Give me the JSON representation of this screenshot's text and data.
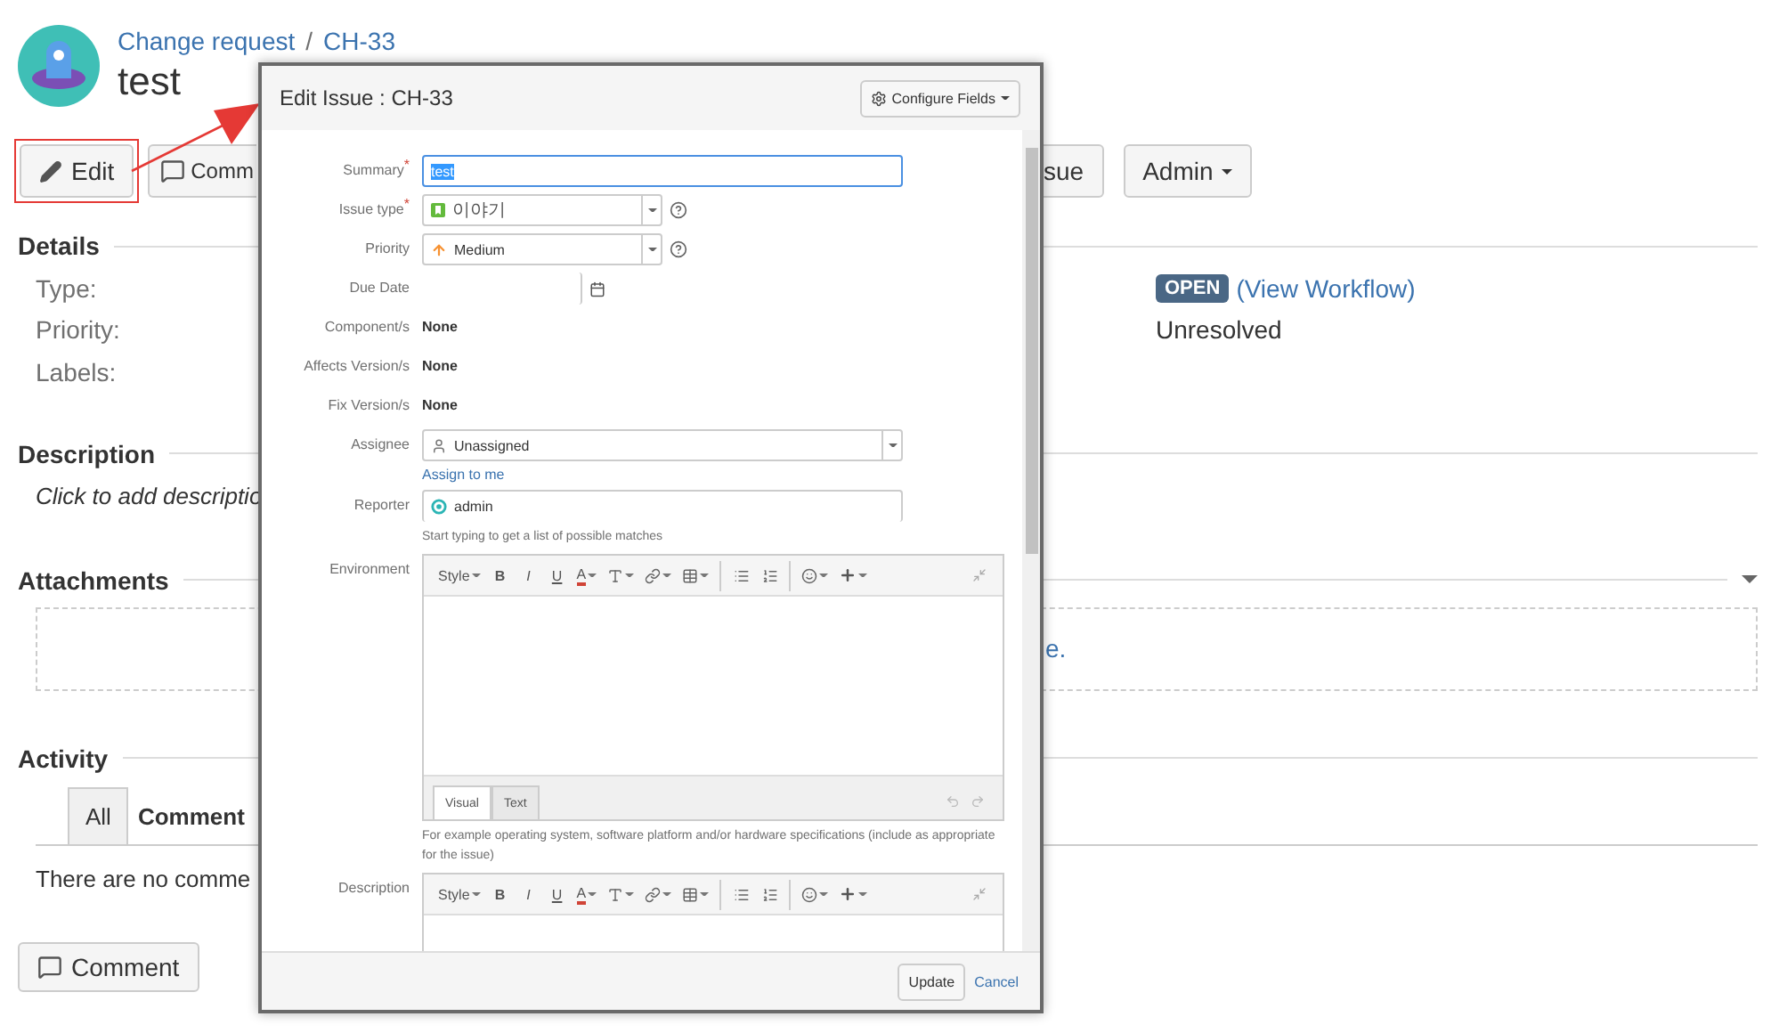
{
  "breadcrumb": {
    "items": [
      "Change request",
      "CH-33"
    ],
    "separator": "/"
  },
  "issue_title": "test",
  "actions_left": [
    {
      "kind": "edit",
      "label": "Edit",
      "highlighted": true
    },
    {
      "kind": "comment",
      "label": "Comm",
      "highlighted": false
    }
  ],
  "actions_right": [
    {
      "kind": "plain",
      "label": "sue"
    },
    {
      "kind": "dropdown",
      "label": "Admin"
    }
  ],
  "details": {
    "heading": "Details",
    "labels": [
      "Type:",
      "Priority:",
      "Labels:"
    ],
    "status": "OPEN",
    "workflow_link": "(View Workflow)",
    "resolution": "Unresolved"
  },
  "description": {
    "heading": "Description",
    "prompt": "Click to add descriptio"
  },
  "attachments": {
    "heading": "Attachments",
    "drop_text": "e."
  },
  "activity": {
    "heading": "Activity",
    "tabs": [
      {
        "label": "All",
        "selected": false
      },
      {
        "label": "Comment",
        "selected": true
      }
    ],
    "empty_text": "There are no comme"
  },
  "comment_button": "Comment",
  "dialog": {
    "title": "Edit Issue : CH-33",
    "configure_button": "Configure Fields",
    "required_mark": "*",
    "fields": [
      {
        "kind": "text",
        "label": "Summary",
        "required": true,
        "value": "test",
        "value_selected": true
      },
      {
        "kind": "issue_type_select",
        "label": "Issue type",
        "required": true,
        "value": "이야기",
        "help": true
      },
      {
        "kind": "priority_select",
        "label": "Priority",
        "required": false,
        "value": "Medium",
        "help": true
      },
      {
        "kind": "date",
        "label": "Due Date",
        "required": false
      },
      {
        "kind": "static",
        "label": "Component/s",
        "required": false,
        "value": "None"
      },
      {
        "kind": "static",
        "label": "Affects Version/s",
        "required": false,
        "value": "None"
      },
      {
        "kind": "static",
        "label": "Fix Version/s",
        "required": false,
        "value": "None"
      },
      {
        "kind": "user_select",
        "label": "Assignee",
        "required": false,
        "value": "Unassigned",
        "link": "Assign to me"
      },
      {
        "kind": "user_input",
        "label": "Reporter",
        "required": false,
        "value": "admin",
        "hint": "Start typing to get a list of possible matches"
      },
      {
        "kind": "editor",
        "label": "Environment",
        "required": false,
        "toolbar": [
          {
            "kind": "menu",
            "label": "Style"
          },
          {
            "kind": "bold",
            "label": "B"
          },
          {
            "kind": "italic",
            "label": "I"
          },
          {
            "kind": "underline",
            "label": "U"
          },
          {
            "kind": "color",
            "label": "A"
          },
          {
            "kind": "size"
          },
          {
            "kind": "link"
          },
          {
            "kind": "table"
          },
          {
            "kind": "divider"
          },
          {
            "kind": "bullets"
          },
          {
            "kind": "numbers"
          },
          {
            "kind": "divider"
          },
          {
            "kind": "emoji"
          },
          {
            "kind": "insert"
          },
          {
            "kind": "collapse"
          }
        ],
        "tabs": [
          {
            "label": "Visual",
            "selected": true
          },
          {
            "label": "Text",
            "selected": false
          }
        ],
        "hint": "For example operating system, software platform and/or hardware specifications (include as appropriate for the issue)"
      },
      {
        "kind": "editor",
        "label": "Description",
        "required": false,
        "toolbar": [
          {
            "kind": "menu",
            "label": "Style"
          },
          {
            "kind": "bold",
            "label": "B"
          },
          {
            "kind": "italic",
            "label": "I"
          },
          {
            "kind": "underline",
            "label": "U"
          },
          {
            "kind": "color",
            "label": "A"
          },
          {
            "kind": "size"
          },
          {
            "kind": "link"
          },
          {
            "kind": "table"
          },
          {
            "kind": "divider"
          },
          {
            "kind": "bullets"
          },
          {
            "kind": "numbers"
          },
          {
            "kind": "divider"
          },
          {
            "kind": "emoji"
          },
          {
            "kind": "insert"
          },
          {
            "kind": "collapse"
          }
        ]
      }
    ],
    "update_button": "Update",
    "cancel_link": "Cancel"
  }
}
